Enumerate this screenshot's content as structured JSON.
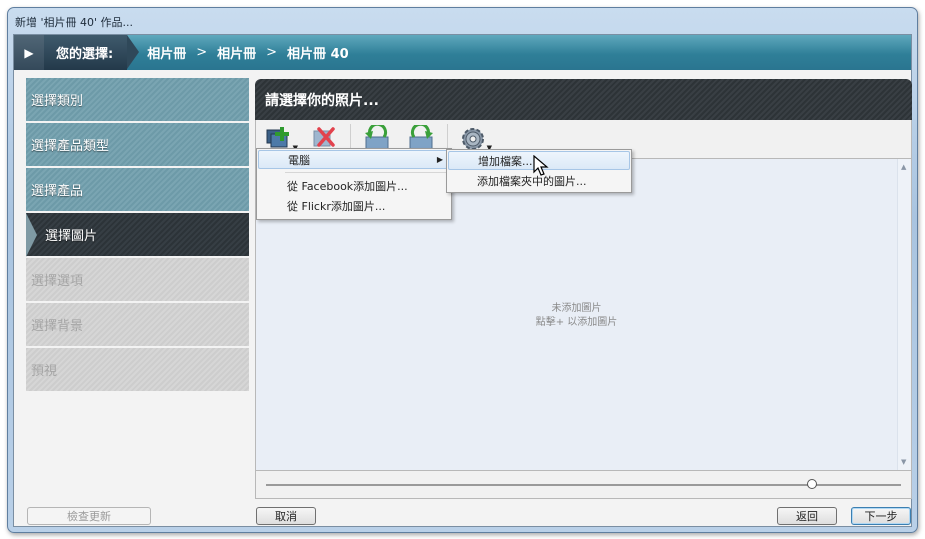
{
  "window": {
    "title": "新增 '相片冊 40' 作品..."
  },
  "breadcrumb": {
    "label": "您的選擇:",
    "items": [
      "相片冊",
      "相片冊",
      "相片冊 40"
    ],
    "separator": ">"
  },
  "steps": [
    {
      "label": "選擇類別",
      "state": "done"
    },
    {
      "label": "選擇產品類型",
      "state": "done"
    },
    {
      "label": "選擇產品",
      "state": "done"
    },
    {
      "label": "選擇圖片",
      "state": "active"
    },
    {
      "label": "選擇選項",
      "state": "disabled"
    },
    {
      "label": "選擇背景",
      "state": "disabled"
    },
    {
      "label": "預視",
      "state": "disabled"
    }
  ],
  "panel": {
    "title": "請選擇你的照片...",
    "empty_line1": "未添加圖片",
    "empty_line2": "點擊+ 以添加圖片"
  },
  "toolbar": {
    "buttons": [
      "add-photos-icon",
      "remove-photo-icon",
      "rotate-left-icon",
      "rotate-right-icon",
      "settings-gear-icon"
    ]
  },
  "menu": {
    "items": [
      {
        "label": "電腦",
        "has_submenu": true,
        "highlighted": true
      },
      {
        "label": "從 Facebook添加圖片..."
      },
      {
        "label": "從 Flickr添加圖片..."
      }
    ]
  },
  "submenu": {
    "items": [
      {
        "label": "增加檔案...",
        "highlighted": true
      },
      {
        "label": "添加檔案夾中的圖片..."
      }
    ]
  },
  "slider": {
    "value": 0.86
  },
  "buttons": {
    "check_updates": "檢查更新",
    "cancel": "取消",
    "back": "返回",
    "next": "下一步"
  },
  "colors": {
    "breadcrumb": "#2f7f98",
    "active_step": "#2c3338",
    "step": "#6d9aa8",
    "content_bg": "#e9eef6"
  }
}
